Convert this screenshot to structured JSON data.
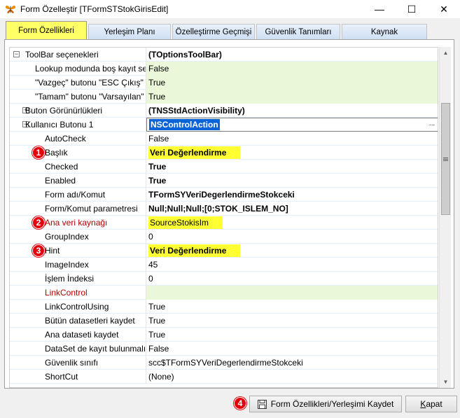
{
  "window": {
    "title": "Form Özelleştir [TFormSTStokGirisEdit]",
    "app_icon": "butterfly-icon",
    "minimize": "—",
    "maximize": "☐",
    "close": "✕"
  },
  "tabs": [
    {
      "label": "Form Özellikleri",
      "active": true
    },
    {
      "label": "Yerleşim Planı"
    },
    {
      "label": "Özelleştirme Geçmişi"
    },
    {
      "label": "Güvenlik Tanımları"
    },
    {
      "label": "Kaynak"
    }
  ],
  "grid": {
    "rows": [
      {
        "name": "ToolBar seçenekleri",
        "value": "(TOptionsToolBar)",
        "expander": "−",
        "value_bold": true
      },
      {
        "name": "Lookup modunda boş kayıt se",
        "value": "False",
        "value_green": true
      },
      {
        "name": "\"Vazgeç\" butonu \"ESC Çıkış\"",
        "value": "True",
        "value_green": true
      },
      {
        "name": "\"Tamam\" butonu \"Varsayılan\"",
        "value": "True",
        "value_green": true
      },
      {
        "name": "Buton Görünürlükleri",
        "value": "(TNSStdActionVisibility)",
        "expander": "+",
        "value_bold": true
      },
      {
        "name": "Kullanıcı Butonu 1",
        "value": "NSControlAction",
        "expander": "−",
        "value_selected": true,
        "ellipsis": "..."
      },
      {
        "name": "AutoCheck",
        "value": "False"
      },
      {
        "name": "Başlık",
        "value": "Veri Değerlendirme",
        "value_bold": true,
        "value_highlight": true,
        "badge": "1"
      },
      {
        "name": "Checked",
        "value": "True",
        "value_bold": true
      },
      {
        "name": "Enabled",
        "value": "True",
        "value_bold": true
      },
      {
        "name": "Form adı/Komut",
        "value": "TFormSYVeriDegerlendirmeStokceki",
        "value_bold": true
      },
      {
        "name": "Form/Komut parametresi",
        "value": "Null;Null;Null;[0;STOK_ISLEM_NO]",
        "value_bold": true
      },
      {
        "name": "Ana veri kaynağı",
        "value": "SourceStokisIm",
        "name_red": true,
        "value_highlight": true,
        "badge": "2"
      },
      {
        "name": "GroupIndex",
        "value": "0"
      },
      {
        "name": "Hint",
        "value": "Veri Değerlendirme",
        "value_bold": true,
        "value_highlight": true,
        "badge": "3"
      },
      {
        "name": "ImageIndex",
        "value": "45"
      },
      {
        "name": "İşlem İndeksi",
        "value": "0"
      },
      {
        "name": "LinkControl",
        "value": "",
        "name_red": true,
        "value_green": true
      },
      {
        "name": "LinkControlUsing",
        "value": "True"
      },
      {
        "name": "Bütün datasetleri kaydet",
        "value": "True"
      },
      {
        "name": "Ana dataseti kaydet",
        "value": "True"
      },
      {
        "name": "DataSet de kayıt bulunmalı",
        "value": "False"
      },
      {
        "name": "Güvenlik sınıfı",
        "value": "scc$TFormSYVeriDegerlendirmeStokceki"
      },
      {
        "name": "ShortCut",
        "value": "(None)"
      }
    ]
  },
  "scrollbar": {
    "up_arrow": "▲",
    "down_arrow": "▼"
  },
  "footer": {
    "badge": "4",
    "save_icon": "floppy-disk-icon",
    "save_label": "Form Özellikleri/Yerleşimi Kaydet",
    "close_label_underlined": "K",
    "close_label_rest": "apat"
  },
  "colors": {
    "active_tab": "#ffff66",
    "highlight": "#ffff33",
    "selection": "#0a64d8",
    "badge": "#e3000b",
    "red_label": "#b00000",
    "green_value_bg": "#eaf7d9"
  }
}
